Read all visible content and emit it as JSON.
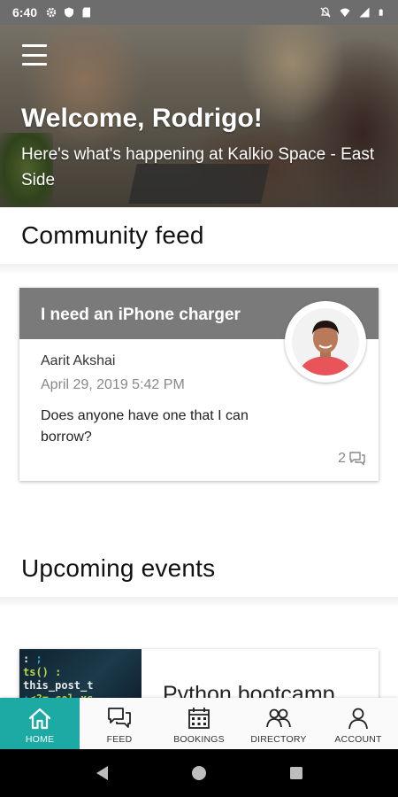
{
  "status_bar": {
    "time": "6:40",
    "left_icons": [
      "gear-icon",
      "shield-icon",
      "sd-card-icon"
    ],
    "right_icons": [
      "notifications-off-icon",
      "wifi-icon",
      "signal-icon",
      "battery-icon"
    ]
  },
  "hero": {
    "title": "Welcome, Rodrigo!",
    "subtitle": "Here's what's happening at Kalkio Space - East Side",
    "menu_icon": "hamburger-menu-icon"
  },
  "community_feed": {
    "title": "Community feed",
    "post": {
      "title": "I need an iPhone charger",
      "author": "Aarit Akshai",
      "date": "April 29, 2019 5:42 PM",
      "body": "Does anyone have one that I can borrow?",
      "comment_count": "2"
    }
  },
  "upcoming_events": {
    "title": "Upcoming events",
    "event": {
      "title": "Python bootcamp"
    }
  },
  "bottom_nav": {
    "items": [
      {
        "label": "HOME",
        "icon": "home-icon",
        "active": true
      },
      {
        "label": "FEED",
        "icon": "chat-bubbles-icon",
        "active": false
      },
      {
        "label": "BOOKINGS",
        "icon": "calendar-icon",
        "active": false
      },
      {
        "label": "DIRECTORY",
        "icon": "people-icon",
        "active": false
      },
      {
        "label": "ACCOUNT",
        "icon": "person-icon",
        "active": false
      }
    ]
  },
  "colors": {
    "accent": "#1daaa5",
    "card_header": "#7a7a7a",
    "status_bar": "#6d6d6d"
  }
}
